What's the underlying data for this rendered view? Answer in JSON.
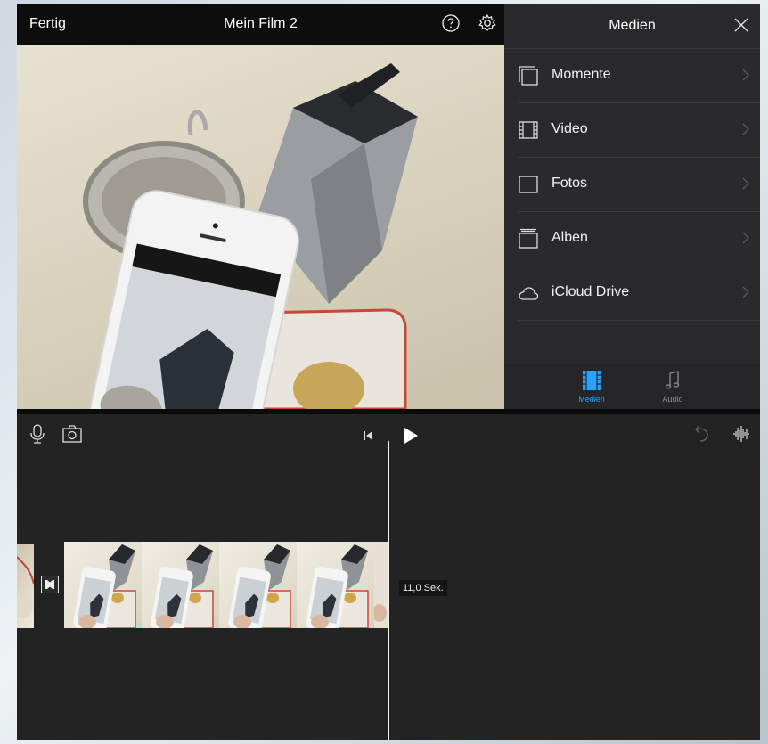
{
  "topbar": {
    "done_label": "Fertig",
    "title": "Mein Film 2",
    "help_icon": "help-icon",
    "settings_icon": "gear-icon"
  },
  "media_panel": {
    "title": "Medien",
    "close_icon": "close-icon",
    "items": [
      {
        "label": "Momente",
        "icon": "moments-icon"
      },
      {
        "label": "Video",
        "icon": "film-icon"
      },
      {
        "label": "Fotos",
        "icon": "photo-icon"
      },
      {
        "label": "Alben",
        "icon": "albums-icon"
      },
      {
        "label": "iCloud Drive",
        "icon": "cloud-icon"
      }
    ],
    "tabs": [
      {
        "label": "Medien",
        "icon": "media-tab-icon",
        "active": true
      },
      {
        "label": "Audio",
        "icon": "music-note-icon",
        "active": false
      }
    ]
  },
  "timeline": {
    "clip_duration": "11,0 Sek."
  },
  "colors": {
    "accent": "#2aa3ff",
    "background": "#1e1e1f",
    "topbar": "#0d0d0d",
    "panel": "#2a2a2c"
  }
}
